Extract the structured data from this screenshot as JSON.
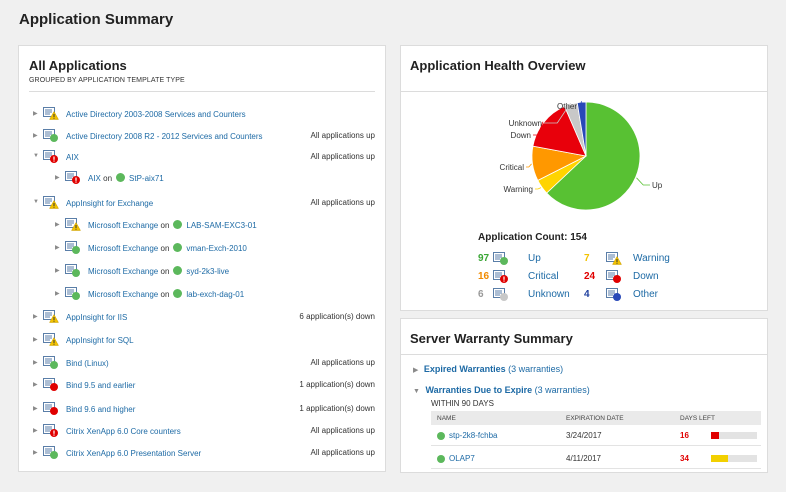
{
  "page": {
    "title": "Application Summary"
  },
  "all_apps": {
    "title": "All Applications",
    "subtitle": "GROUPED BY APPLICATION TEMPLATE TYPE",
    "rows": [
      {
        "label": "Active Directory 2003-2008 Services and Counters",
        "status": "",
        "badge": "warning",
        "expanded": false
      },
      {
        "label": "Active Directory 2008 R2 - 2012 Services and Counters",
        "status": "All applications up",
        "badge": "up",
        "expanded": false
      },
      {
        "label": "AIX",
        "status": "All applications up",
        "badge": "critical",
        "expanded": true
      },
      {
        "label": "AIX",
        "on": "on",
        "node": "StP-aix71",
        "status": "",
        "badge": "critical",
        "child": true
      },
      {
        "label": "AppInsight for Exchange",
        "status": "All applications up",
        "badge": "warning",
        "expanded": true
      },
      {
        "label": "Microsoft Exchange",
        "on": "on",
        "node": "LAB-SAM-EXC3-01",
        "status": "",
        "badge": "warning",
        "child": true
      },
      {
        "label": "Microsoft Exchange",
        "on": "on",
        "node": "vman-Exch-2010",
        "status": "",
        "badge": "up",
        "child": true
      },
      {
        "label": "Microsoft Exchange",
        "on": "on",
        "node": "syd-2k3-live",
        "status": "",
        "badge": "up",
        "child": true
      },
      {
        "label": "Microsoft Exchange",
        "on": "on",
        "node": "lab-exch-dag-01",
        "status": "",
        "badge": "up",
        "child": true
      },
      {
        "label": "AppInsight for IIS",
        "status": "6 application(s) down",
        "badge": "warning",
        "expanded": false
      },
      {
        "label": "AppInsight for SQL",
        "status": "",
        "badge": "warning",
        "expanded": false
      },
      {
        "label": "Bind (Linux)",
        "status": "All applications up",
        "badge": "up",
        "expanded": false
      },
      {
        "label": "Bind 9.5 and earlier",
        "status": "1 application(s) down",
        "badge": "down",
        "expanded": false
      },
      {
        "label": "Bind 9.6 and higher",
        "status": "1 application(s) down",
        "badge": "down",
        "expanded": false
      },
      {
        "label": "Citrix XenApp 6.0 Core counters",
        "status": "All applications up",
        "badge": "critical",
        "expanded": false
      },
      {
        "label": "Citrix XenApp 6.0 Presentation Server",
        "status": "All applications up",
        "badge": "up",
        "expanded": false
      }
    ]
  },
  "health": {
    "title": "Application Health Overview",
    "count_label": "Application Count: 154",
    "pie_labels": {
      "other": "Other",
      "unknown": "Unknown",
      "down": "Down",
      "critical": "Critical",
      "warning": "Warning",
      "up": "Up"
    },
    "legend": [
      {
        "key": "up",
        "count": "97",
        "name": "Up",
        "color": "#3aa635"
      },
      {
        "key": "warning",
        "count": "7",
        "name": "Warning",
        "color": "#f2c200"
      },
      {
        "key": "critical",
        "count": "16",
        "name": "Critical",
        "color": "#f08a00"
      },
      {
        "key": "down",
        "count": "24",
        "name": "Down",
        "color": "#e00000"
      },
      {
        "key": "unknown",
        "count": "6",
        "name": "Unknown",
        "color": "#999999"
      },
      {
        "key": "other",
        "count": "4",
        "name": "Other",
        "color": "#1e3f9e"
      }
    ],
    "colors": {
      "up": "#58c133",
      "warning": "#ffd400",
      "critical": "#ff9800",
      "down": "#e8000b",
      "unknown": "#c8c8c8",
      "other": "#2849b8"
    }
  },
  "warranty": {
    "title": "Server Warranty Summary",
    "expired": {
      "label": "Expired Warranties",
      "count": "(3 warranties)"
    },
    "due": {
      "label": "Warranties Due to Expire",
      "count": "(3 warranties)"
    },
    "within": "WITHIN 90 DAYS",
    "columns": {
      "name": "NAME",
      "date": "EXPIRATION DATE",
      "days": "DAYS LEFT"
    },
    "rows": [
      {
        "name": "stp-2k8-fchba",
        "date": "3/24/2017",
        "days": "16",
        "days_color": "#e00000",
        "fill_fraction": 0.18,
        "fill_color": "#e00000"
      },
      {
        "name": "OLAP7",
        "date": "4/11/2017",
        "days": "34",
        "days_color": "#e00000",
        "fill_fraction": 0.38,
        "fill_color": "#f2d000"
      }
    ]
  }
}
